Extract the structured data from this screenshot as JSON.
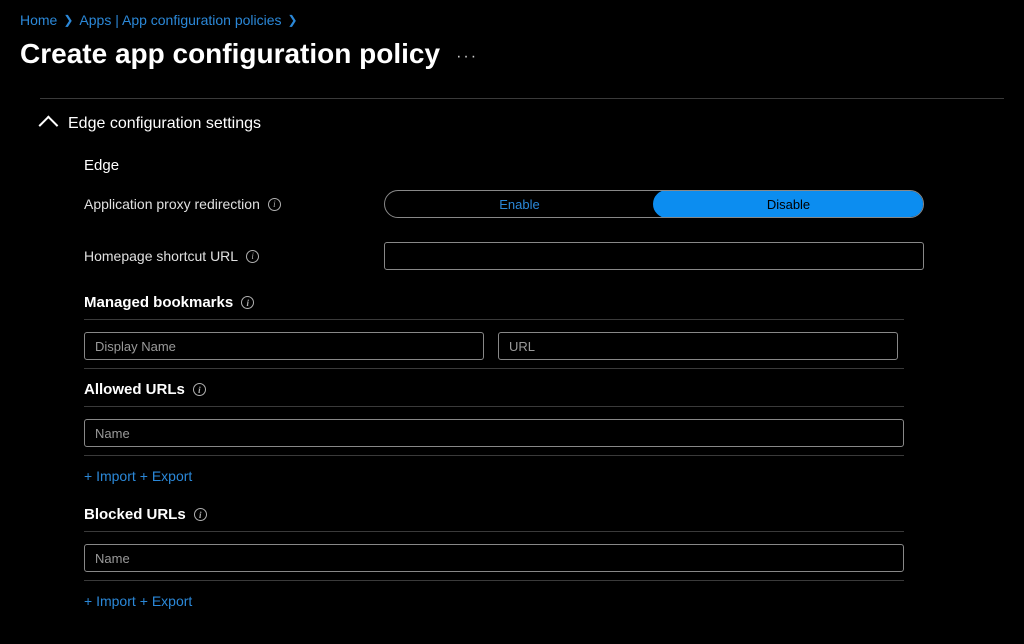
{
  "breadcrumb": {
    "home": "Home",
    "apps": "Apps | App configuration policies"
  },
  "page": {
    "title": "Create app configuration policy"
  },
  "section": {
    "title": "Edge configuration settings"
  },
  "edge": {
    "heading": "Edge",
    "proxy_label": "Application proxy redirection",
    "enable_label": "Enable",
    "disable_label": "Disable",
    "homepage_label": "Homepage shortcut URL",
    "homepage_value": ""
  },
  "bookmarks": {
    "title": "Managed bookmarks",
    "display_name_placeholder": "Display Name",
    "url_placeholder": "URL"
  },
  "allowed_urls": {
    "title": "Allowed URLs",
    "name_placeholder": "Name",
    "import_label": "+ Import",
    "export_label": "+ Export"
  },
  "blocked_urls": {
    "title": "Blocked URLs",
    "name_placeholder": "Name",
    "import_label": "+ Import",
    "export_label": "+ Export"
  }
}
